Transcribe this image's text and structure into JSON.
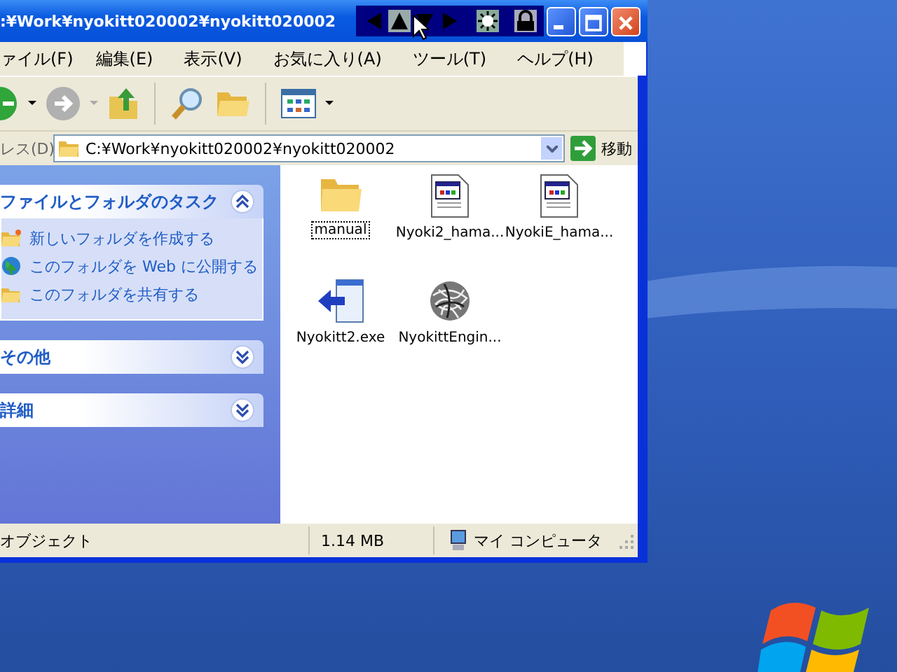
{
  "window": {
    "title": ":¥Work¥nyokitt020002¥nyokitt020002"
  },
  "menu": [
    "ァイル(F)",
    "編集(E)",
    "表示(V)",
    "お気に入り(A)",
    "ツール(T)",
    "ヘルプ(H)"
  ],
  "address": {
    "label": "レス(D)",
    "value": "C:¥Work¥nyokitt020002¥nyokitt020002",
    "go": "移動"
  },
  "task_panels": [
    {
      "title": "ファイルとフォルダのタスク",
      "expanded": true,
      "items": [
        {
          "label": "新しいフォルダを作成する",
          "kind": "new-folder"
        },
        {
          "label": "このフォルダを Web に公開する",
          "kind": "publish"
        },
        {
          "label": "このフォルダを共有する",
          "kind": "share"
        }
      ]
    },
    {
      "title": "その他",
      "expanded": false
    },
    {
      "title": "詳細",
      "expanded": false
    }
  ],
  "files": [
    {
      "name": "manual",
      "kind": "folder",
      "selected": true
    },
    {
      "name": "Nyoki2_hama...",
      "kind": "html",
      "selected": false
    },
    {
      "name": "NyokiE_hama...",
      "kind": "html",
      "selected": false
    },
    {
      "name": "Nyokitt2.exe",
      "kind": "shortcut",
      "selected": false
    },
    {
      "name": "NyokittEngin...",
      "kind": "engine",
      "selected": false
    }
  ],
  "status_bar": {
    "objects": "オブジェクト",
    "size": "1.14 MB",
    "location": "マイ コンピュータ"
  }
}
